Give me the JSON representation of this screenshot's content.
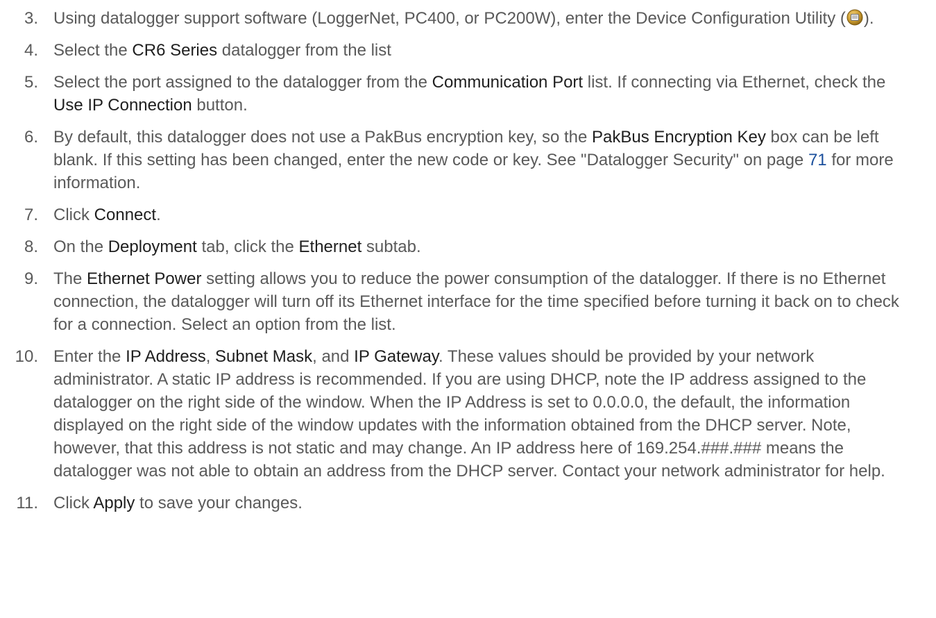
{
  "steps": [
    {
      "num": "3.",
      "parts": [
        {
          "t": "Using datalogger support software (LoggerNet, PC400, or PC200W), enter the Device Configuration Utility ("
        },
        {
          "icon": "device-configuration-utility-icon"
        },
        {
          "t": ")."
        }
      ]
    },
    {
      "num": "4.",
      "parts": [
        {
          "t": "Select the "
        },
        {
          "b": "CR6 Series"
        },
        {
          "t": " datalogger from the list"
        }
      ]
    },
    {
      "num": "5.",
      "parts": [
        {
          "t": "Select the port assigned to the datalogger from the "
        },
        {
          "b": "Communication Port"
        },
        {
          "t": " list. If connecting via Ethernet, check the "
        },
        {
          "b": "Use IP Connection"
        },
        {
          "t": " button."
        }
      ]
    },
    {
      "num": "6.",
      "parts": [
        {
          "t": "By default, this datalogger does not use a PakBus encryption key, so the "
        },
        {
          "b": "PakBus Encryption Key"
        },
        {
          "t": " box can be left blank. If this setting has been changed, enter the new code or key. See \"Datalogger Security\" on page "
        },
        {
          "link": "71"
        },
        {
          "t": " for more information."
        }
      ]
    },
    {
      "num": "7.",
      "parts": [
        {
          "t": "Click "
        },
        {
          "b": "Connect"
        },
        {
          "t": "."
        }
      ]
    },
    {
      "num": "8.",
      "parts": [
        {
          "t": "On the "
        },
        {
          "b": "Deployment"
        },
        {
          "t": " tab, click the "
        },
        {
          "b": "Ethernet"
        },
        {
          "t": " subtab."
        }
      ]
    },
    {
      "num": "9.",
      "parts": [
        {
          "t": "The "
        },
        {
          "b": "Ethernet Power"
        },
        {
          "t": " setting allows you to reduce the power consumption of the datalogger. If there is no Ethernet connection, the datalogger will turn off its Ethernet interface for the time specified before turning it back on to check for a connection. Select an option from the list."
        }
      ]
    },
    {
      "num": "10.",
      "parts": [
        {
          "t": "Enter the "
        },
        {
          "b": "IP Address"
        },
        {
          "t": ", "
        },
        {
          "b": "Subnet Mask"
        },
        {
          "t": ", and "
        },
        {
          "b": "IP Gateway"
        },
        {
          "t": ". These values should be provided by your network administrator. A static IP address is recommended. If you are using DHCP, note the IP address assigned to the datalogger on the right side of the window. When the IP Address is set to 0.0.0.0, the default, the information displayed on the right side of the window updates with the information obtained from the DHCP server. Note, however, that this address is not static and may change. An IP address here of 169.254.###.### means the datalogger was not able to obtain an address from the DHCP server. Contact your network administrator for help."
        }
      ]
    },
    {
      "num": "11.",
      "parts": [
        {
          "t": "Click "
        },
        {
          "b": "Apply"
        },
        {
          "t": " to save your changes."
        }
      ]
    }
  ]
}
